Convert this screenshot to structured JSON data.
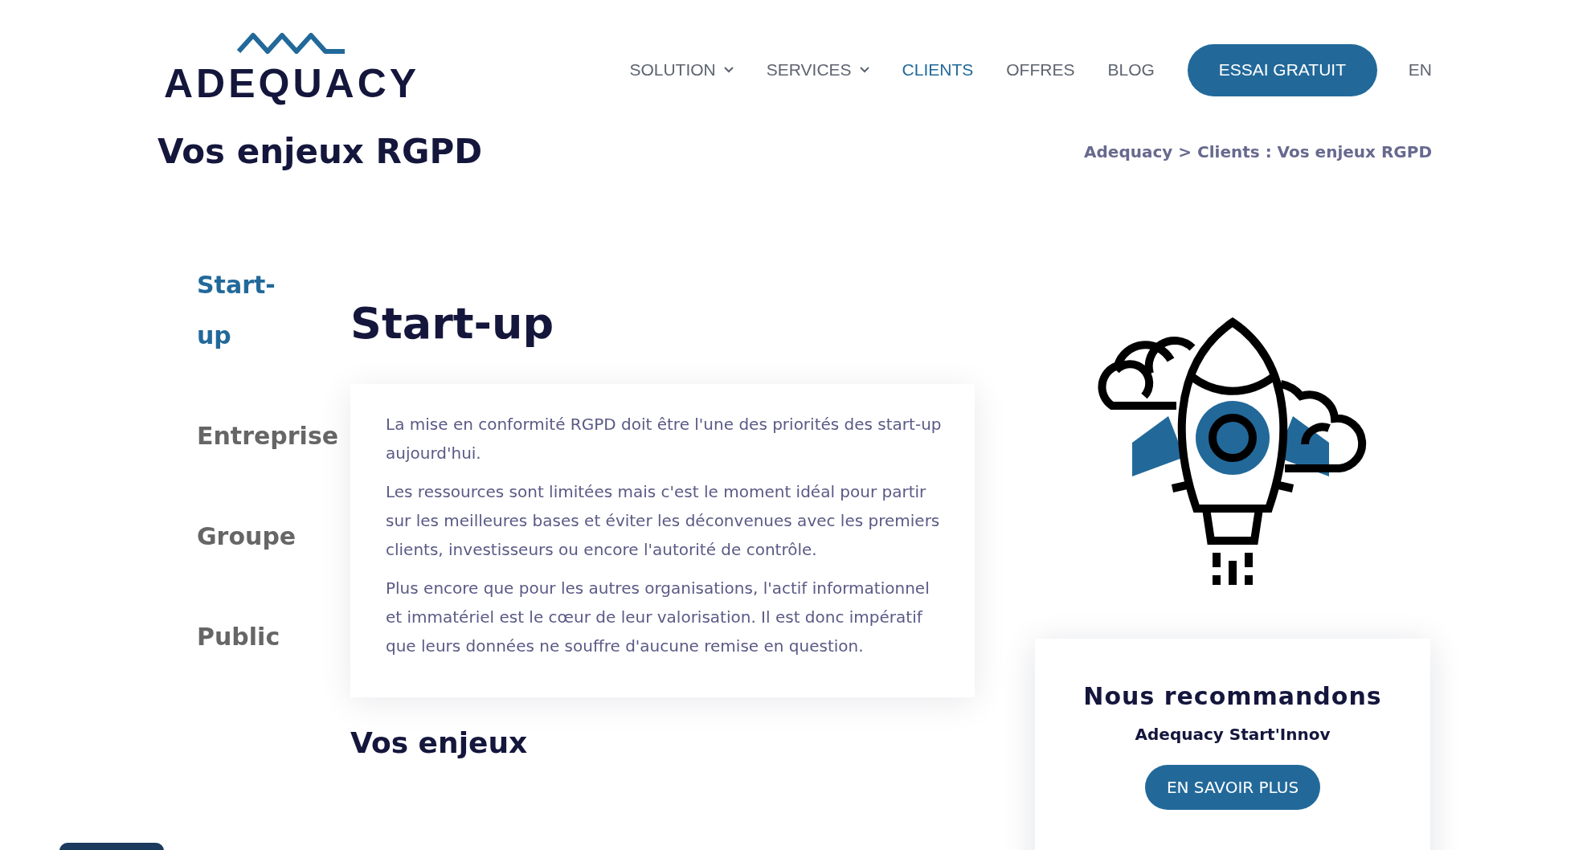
{
  "logo": {
    "text": "ADEQUACY"
  },
  "nav": {
    "items": [
      {
        "label": "SOLUTION",
        "dropdown": true,
        "selected": false
      },
      {
        "label": "SERVICES",
        "dropdown": true,
        "selected": false
      },
      {
        "label": "CLIENTS",
        "dropdown": false,
        "selected": true
      },
      {
        "label": "OFFRES",
        "dropdown": false,
        "selected": false
      },
      {
        "label": "BLOG",
        "dropdown": false,
        "selected": false
      }
    ],
    "cta": "ESSAI GRATUIT",
    "language": "EN"
  },
  "page_title": "Vos enjeux RGPD",
  "breadcrumb": "Adequacy > Clients : Vos enjeux RGPD",
  "side_tabs": [
    {
      "label": "Start-up",
      "selected": true
    },
    {
      "label": "Entreprise",
      "selected": false
    },
    {
      "label": "Groupe",
      "selected": false
    },
    {
      "label": "Public",
      "selected": false
    }
  ],
  "section": {
    "heading": "Start-up",
    "paragraphs": [
      "La mise en conformité RGPD doit être l'une des priorités des start-up aujourd'hui.",
      "Les ressources sont limitées mais c'est le moment idéal pour partir sur les meilleures bases et éviter les déconvenues avec les premiers clients, investisseurs ou encore l'autorité de contrôle.",
      "Plus encore que pour les autres organisations, l'actif informationnel et immatériel est le cœur de leur valorisation. Il est donc impératif que leurs données ne souffre d'aucune remise en question."
    ],
    "subheading": "Vos enjeux"
  },
  "recommendation": {
    "title": "Nous recommandons",
    "product": "Adequacy Start'Innov",
    "button": "EN SAVOIR PLUS"
  }
}
